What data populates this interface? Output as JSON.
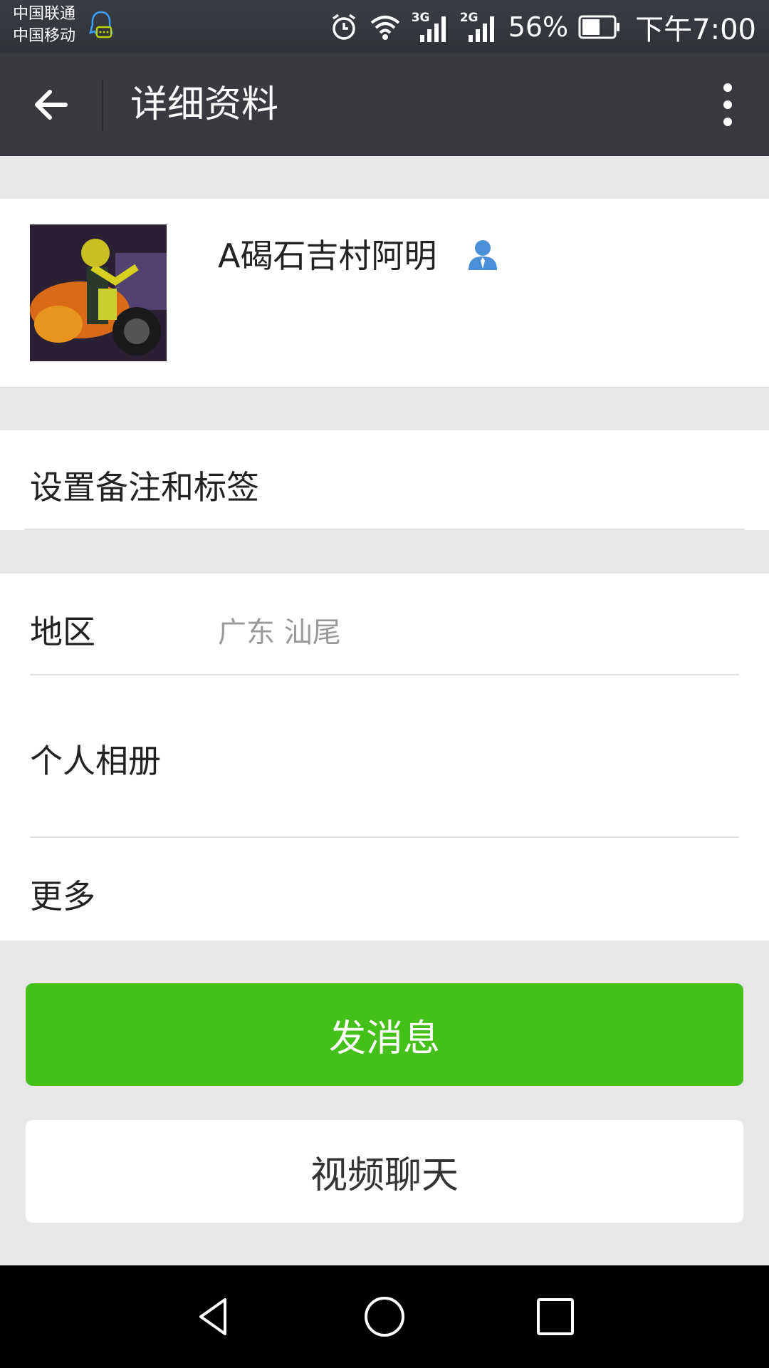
{
  "status_bar": {
    "carrier_1": "中国联通",
    "carrier_2": "中国移动",
    "signal_1_tag": "3G",
    "signal_2_tag": "2G",
    "battery_percent": "56%",
    "time": "下午7:00"
  },
  "app_bar": {
    "title": "详细资料"
  },
  "profile": {
    "name": "A碣石吉村阿明"
  },
  "remark_row": {
    "label": "设置备注和标签"
  },
  "info_rows": [
    {
      "label": "地区",
      "value": "广东  汕尾"
    },
    {
      "label": "个人相册"
    },
    {
      "label": "更多"
    }
  ],
  "actions": {
    "send_message": "发消息",
    "video_chat": "视频聊天"
  },
  "colors": {
    "primary_green": "#45c01a",
    "appbar_bg": "#393a3f",
    "contact_icon_blue": "#4a90d9"
  }
}
